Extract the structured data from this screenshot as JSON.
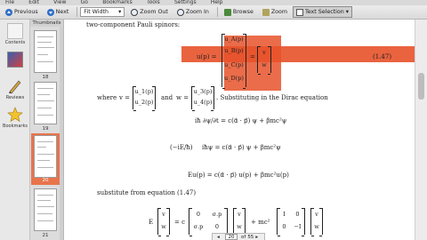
{
  "menu": [
    "File",
    "Edit",
    "View",
    "Go",
    "Bookmarks",
    "Tools",
    "Settings",
    "Help"
  ],
  "toolbar": {
    "previous": "Previous",
    "next": "Next",
    "zoom_mode": "Fit Width",
    "zoom_out": "Zoom Out",
    "zoom_in": "Zoom In",
    "browse": "Browse",
    "zoom": "Zoom",
    "text_selection": "Text Selection"
  },
  "dock": {
    "contents": "Contents",
    "thumbnails": "Thumbnails",
    "reviews": "Reviews",
    "bookmarks": "Bookmarks"
  },
  "thumbnails": {
    "title": "Thumbnails",
    "pages": [
      "18",
      "19",
      "20",
      "21"
    ],
    "selected": "20"
  },
  "document": {
    "top_text": "two-component Pauli spinors:",
    "eq147_lhs": "u(p) =",
    "eq147_col": [
      "u_A(p)",
      "u_B(p)",
      "u_C(p)",
      "u_D(p)"
    ],
    "eq147_rhs_top": "v",
    "eq147_rhs_bottom": "w",
    "eq147_num": "(1.47)",
    "where_text": "where",
    "v_eq": "v =",
    "v_col": [
      "u_1(p)",
      "u_2(p)"
    ],
    "and_text": "and",
    "w_eq": "w =",
    "w_col": [
      "u_3(p)",
      "u_4(p)"
    ],
    "substituting_text": ". Substituting in the Dirac equation",
    "dirac1": "iħ ∂ψ/∂t = c(α⃗ · p⃗) ψ + βmc²ψ",
    "dirac2_lhs": "(−iE/ħ)",
    "dirac2_rhs": "iħψ = c(α⃗ · p⃗) ψ + βmc²ψ",
    "dirac3": "Eu(p) = c(α⃗ · p⃗) u(p) + βmc²u(p)",
    "substitute_text": "substitute from equation (1.47)",
    "final_E": "E",
    "final_v": "v",
    "final_w": "w",
    "final_eq": "= c",
    "final_sigma": [
      "0",
      "σ.p",
      "σ.p",
      "0"
    ],
    "final_plus": "+ mc²",
    "final_I": [
      "I",
      "0",
      "0",
      "−I"
    ]
  },
  "pagenav": {
    "current": "20",
    "of": "of",
    "total": "55"
  },
  "colors": {
    "highlight": "#e8522a",
    "selected_thumb": "#e8744b",
    "toolbar_bg": "#dadada"
  }
}
